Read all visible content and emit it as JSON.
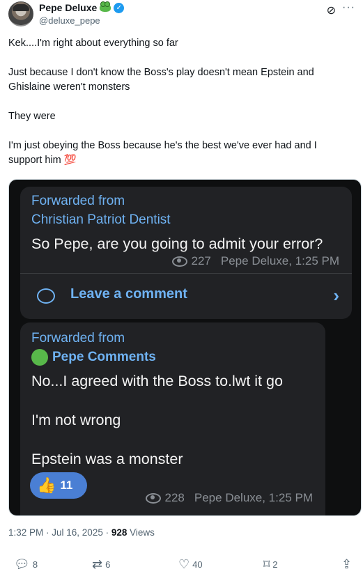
{
  "author": {
    "name": "Pepe Deluxe",
    "handle": "@deluxe_pepe"
  },
  "tweet": {
    "paragraphs": [
      "Kek....I'm right about everything so far",
      "Just because I don't know the Boss's play doesn't mean Epstein and Ghislaine weren't monsters",
      "They were",
      "I'm just obeying the Boss because he's the best we've ever had and I support him 💯"
    ]
  },
  "media": {
    "message1": {
      "forwarded_label": "Forwarded from",
      "forwarded_from": "Christian Patriot Dentist",
      "text": "So Pepe, are you going to admit your error?",
      "views": "227",
      "meta": "Pepe Deluxe, 1:25 PM",
      "comment_label": "Leave a comment"
    },
    "message2": {
      "forwarded_label": "Forwarded from",
      "forwarded_from": "Pepe Comments",
      "lines": [
        "No...I agreed with the Boss to.lwt it go",
        "I'm not wrong",
        "Epstein was a monster"
      ],
      "reaction_count": "11",
      "views": "228",
      "meta": "Pepe Deluxe, 1:25 PM"
    }
  },
  "footer": {
    "timestamp": "1:32 PM · Jul 16, 2025 · ",
    "views_count": "928",
    "views_label": " Views"
  },
  "actions": {
    "replies": "8",
    "reposts": "6",
    "likes": "40",
    "bookmarks": "2"
  },
  "icons": [
    "avatar",
    "frog-emoji-icon",
    "verified-badge-icon",
    "grok-icon",
    "more-icon",
    "eye-icon",
    "comment-icon",
    "chevron-right-icon",
    "thumbs-up-icon",
    "reply-icon",
    "repost-icon",
    "like-icon",
    "bookmark-icon",
    "share-icon"
  ],
  "colors": {
    "link_blue": "#6fb2f2",
    "verified": "#1d9bf0",
    "bubble_bg": "#212225",
    "reaction_bg": "#4a7fd4"
  }
}
